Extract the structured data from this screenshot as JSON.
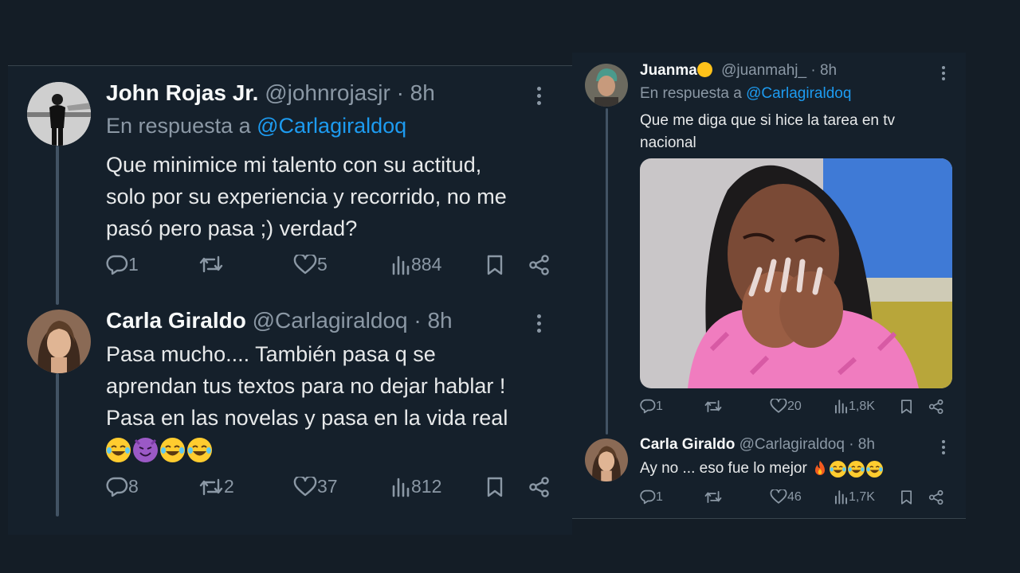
{
  "left": {
    "tweets": [
      {
        "name": "John Rojas Jr.",
        "handle": "@johnrojasjr",
        "time": "· 8h",
        "reply_prefix": "En respuesta a",
        "reply_to": "@Carlagiraldoq",
        "text": [
          "Que minimice mi talento con su actitud,",
          "solo por su experiencia y recorrido, no me",
          "pasó pero pasa ;) verdad?"
        ],
        "replies": "1",
        "retweets": "",
        "likes": "5",
        "views": "884"
      },
      {
        "name": "Carla Giraldo",
        "handle": "@Carlagiraldoq",
        "time": "· 8h",
        "text": [
          "Pasa mucho.... También pasa q se",
          "aprendan tus textos para no dejar hablar !",
          "Pasa en las novelas y pasa en la vida real"
        ],
        "emojis": [
          "laughing-tears",
          "smiling-devil",
          "laughing-tears",
          "laughing-tears"
        ],
        "replies": "8",
        "retweets": "2",
        "likes": "37",
        "views": "812"
      }
    ]
  },
  "right": {
    "tweets": [
      {
        "name": "Juanma",
        "name_emoji": "yellow-circle",
        "handle": "@juanmahj_",
        "time": "· 8h",
        "reply_prefix": "En respuesta a",
        "reply_to": "@Carlagiraldoq",
        "text": [
          "Que me diga que si hice la tarea en tv",
          "nacional"
        ],
        "media": "photo of a laughing woman in a pink pajama covering her mouth with her hands",
        "replies": "1",
        "retweets": "",
        "likes": "20",
        "views": "1,8K"
      },
      {
        "name": "Carla Giraldo",
        "handle": "@Carlagiraldoq",
        "time": "· 8h",
        "text": "Ay no ... eso fue lo mejor",
        "emojis": [
          "fire",
          "laughing-tears",
          "laughing-tears",
          "laughing-tears"
        ],
        "replies": "1",
        "retweets": "",
        "likes": "46",
        "views": "1,7K"
      }
    ]
  },
  "colors": {
    "background": "#15202b",
    "link": "#1d9bf0",
    "muted": "#8b98a5",
    "text": "#e7e9ea",
    "thread_line": "#425364"
  }
}
